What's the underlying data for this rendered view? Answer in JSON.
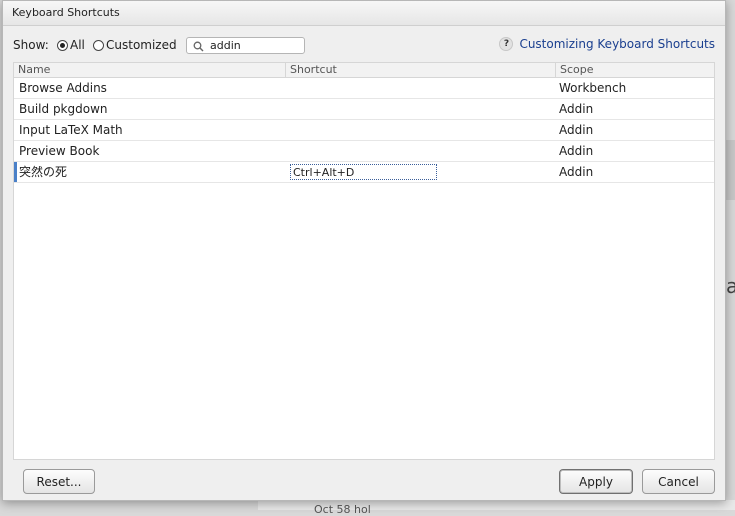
{
  "dialog": {
    "title": "Keyboard Shortcuts",
    "show_label": "Show:",
    "filter_options": [
      {
        "label": "All",
        "selected": true
      },
      {
        "label": "Customized",
        "selected": false
      }
    ],
    "search": {
      "value": "addin",
      "icon": "search-icon"
    },
    "help": {
      "icon_glyph": "?",
      "link_label": "Customizing Keyboard Shortcuts"
    }
  },
  "table": {
    "columns": [
      "Name",
      "Shortcut",
      "Scope"
    ],
    "rows": [
      {
        "name": "Browse Addins",
        "shortcut": "",
        "scope": "Workbench"
      },
      {
        "name": "Build pkgdown",
        "shortcut": "",
        "scope": "Addin"
      },
      {
        "name": "Input LaTeX Math",
        "shortcut": "",
        "scope": "Addin"
      },
      {
        "name": "Preview Book",
        "shortcut": "",
        "scope": "Addin"
      },
      {
        "name": "突然の死",
        "shortcut": "Ctrl+Alt+D",
        "scope": "Addin",
        "editing": true
      }
    ]
  },
  "buttons": {
    "reset": "Reset...",
    "apply": "Apply",
    "cancel": "Cancel"
  },
  "background": {
    "partial_text": "a",
    "bottom_text": "Oct 58 hol"
  },
  "colors": {
    "link": "#1a3f8f",
    "selection": "#4a80c8"
  }
}
